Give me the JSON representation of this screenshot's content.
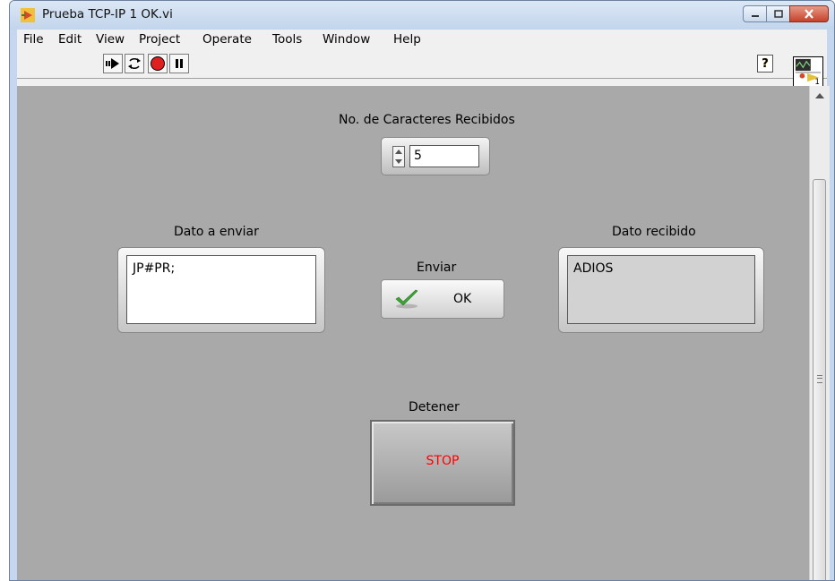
{
  "window": {
    "title": "Prueba TCP-IP 1 OK.vi"
  },
  "menu": [
    "File",
    "Edit",
    "View",
    "Project",
    "Operate",
    "Tools",
    "Window",
    "Help"
  ],
  "toolbar": {
    "icons": [
      "run-arrow-icon",
      "run-continuously-icon",
      "abort-icon",
      "pause-icon"
    ],
    "help_label": "?"
  },
  "vi_icon_text": "1",
  "panel": {
    "chars_label": "No. de Caracteres Recibidos",
    "chars_value": "5",
    "send_label": "Dato a enviar",
    "send_value": "JP#PR;",
    "recv_label": "Dato recibido",
    "recv_value": "ADIOS",
    "enviar_label": "Enviar",
    "ok_label": "OK",
    "detener_label": "Detener",
    "stop_label": "STOP"
  },
  "colors": {
    "panel_bg": "#a9a9a9",
    "stop_text": "#ff0000",
    "check_green": "#3da336"
  }
}
